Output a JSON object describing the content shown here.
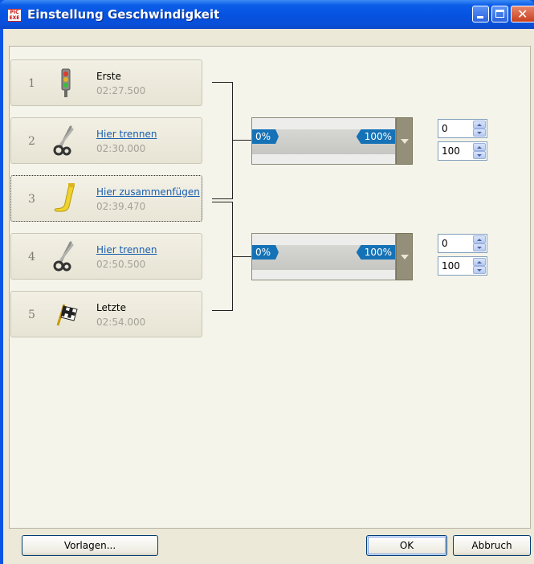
{
  "window": {
    "title": "Einstellung Geschwindigkeit",
    "app_icon_text": "PIC EXE",
    "close_glyph": "✕"
  },
  "stops": [
    {
      "num": "1",
      "name": "Erste",
      "time": "02:27.500",
      "icon": "traffic-light-icon",
      "link": false
    },
    {
      "num": "2",
      "name": "Hier trennen",
      "time": "02:30.000",
      "icon": "scissors-icon",
      "link": true
    },
    {
      "num": "3",
      "name": "Hier zusammenfügen",
      "time": "02:39.470",
      "icon": "glue-tube-icon",
      "link": true
    },
    {
      "num": "4",
      "name": "Hier trennen",
      "time": "02:50.500",
      "icon": "scissors-icon",
      "link": true
    },
    {
      "num": "5",
      "name": "Letzte",
      "time": "02:54.000",
      "icon": "checkered-flag-icon",
      "link": false
    }
  ],
  "segments": [
    {
      "start_label": "0%",
      "end_label": "100%",
      "start_value": "0",
      "end_value": "100"
    },
    {
      "start_label": "0%",
      "end_label": "100%",
      "start_value": "0",
      "end_value": "100"
    }
  ],
  "buttons": {
    "templates": "Vorlagen...",
    "ok": "OK",
    "cancel": "Abbruch"
  },
  "colors": {
    "titlebar": "#0552e0",
    "label_blue": "#1572b6",
    "link": "#1a5fb0"
  }
}
